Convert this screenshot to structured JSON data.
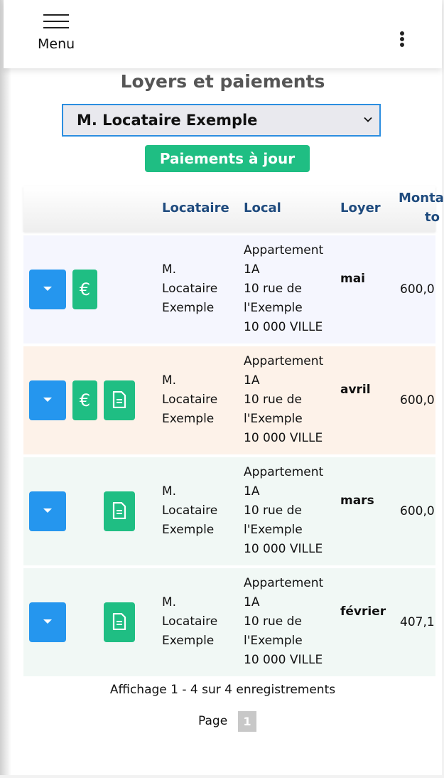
{
  "header": {
    "menu_label": "Menu"
  },
  "page": {
    "title": "Loyers et paiements",
    "tenant_select": "M. Locataire Exemple",
    "paid_button": "Paiements à jour"
  },
  "table": {
    "headers": {
      "tenant": "Locataire",
      "local": "Local",
      "rent": "Loyer",
      "amount_line1": "Monta",
      "amount_line2": "to"
    },
    "rows": [
      {
        "tenant": [
          "M.",
          "Locataire",
          "Exemple"
        ],
        "local": [
          "Appartement",
          "1A",
          "10 rue de",
          "l'Exemple",
          "10 000 VILLE"
        ],
        "month": "mai",
        "amount": "600,0",
        "euro_button": "€",
        "row_color": "#f5f6fe"
      },
      {
        "tenant": [
          "M.",
          "Locataire",
          "Exemple"
        ],
        "local": [
          "Appartement",
          "1A",
          "10 rue de",
          "l'Exemple",
          "10 000 VILLE"
        ],
        "month": "avril",
        "amount": "600,0",
        "euro_button": "€",
        "row_color": "#fdf2e9"
      },
      {
        "tenant": [
          "M.",
          "Locataire",
          "Exemple"
        ],
        "local": [
          "Appartement",
          "1A",
          "10 rue de",
          "l'Exemple",
          "10 000 VILLE"
        ],
        "month": "mars",
        "amount": "600,0",
        "row_color": "#f1f8f5"
      },
      {
        "tenant": [
          "M.",
          "Locataire",
          "Exemple"
        ],
        "local": [
          "Appartement",
          "1A",
          "10 rue de",
          "l'Exemple",
          "10 000 VILLE"
        ],
        "month": "février",
        "amount": "407,1",
        "row_color": "#f1f8f5"
      }
    ]
  },
  "footer": {
    "record_count": "Affichage 1 - 4 sur 4 enregistrements",
    "page_label": "Page",
    "current_page": "1"
  },
  "colors": {
    "accent_blue": "#2596ee",
    "accent_green": "#1fbe83",
    "select_border": "#2b8ee0",
    "header_text": "#1f4b7e"
  },
  "icons": [
    "hamburger-icon",
    "kebab-menu-icon",
    "chevron-down-icon",
    "caret-down-icon",
    "euro-icon",
    "document-icon"
  ]
}
